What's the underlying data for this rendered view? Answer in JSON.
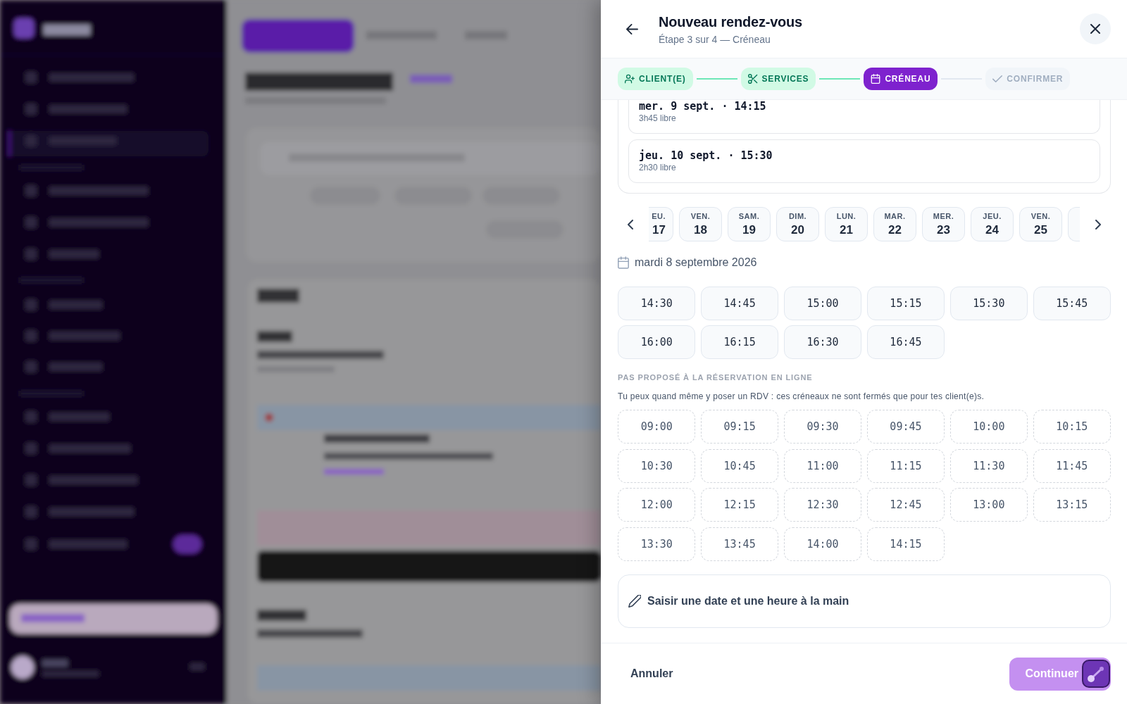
{
  "header": {
    "title": "Nouveau rendez-vous",
    "subtitle": "Étape 3 sur 4 — Créneau"
  },
  "steps": [
    {
      "label": "CLIENT(E)",
      "completed": true,
      "selected": false
    },
    {
      "label": "SERVICES",
      "completed": true,
      "selected": false
    },
    {
      "label": "CRÉNEAU",
      "completed": false,
      "selected": true
    },
    {
      "label": "CONFIRMER",
      "completed": false,
      "selected": false
    }
  ],
  "suggestions": [
    {
      "title": "mer. 9 sept. · 14:15",
      "note": "3h45 libre",
      "selected": false
    },
    {
      "title": "jeu. 10 sept. · 15:30",
      "note": "2h30 libre",
      "selected": false
    }
  ],
  "days": [
    {
      "weekday": "EU.",
      "day": "17",
      "partial": true,
      "selected": false
    },
    {
      "weekday": "VEN.",
      "day": "18",
      "partial": false,
      "selected": false
    },
    {
      "weekday": "SAM.",
      "day": "19",
      "partial": false,
      "selected": false
    },
    {
      "weekday": "DIM.",
      "day": "20",
      "partial": false,
      "selected": false
    },
    {
      "weekday": "LUN.",
      "day": "21",
      "partial": false,
      "selected": false
    },
    {
      "weekday": "MAR.",
      "day": "22",
      "partial": false,
      "selected": false
    },
    {
      "weekday": "MER.",
      "day": "23",
      "partial": false,
      "selected": false
    },
    {
      "weekday": "JEU.",
      "day": "24",
      "partial": false,
      "selected": false
    },
    {
      "weekday": "VEN.",
      "day": "25",
      "partial": false,
      "selected": false
    },
    {
      "partial": true,
      "selected": false
    }
  ],
  "date_label": "mardi 8 septembre 2026",
  "slots": [
    {
      "time": "14:30",
      "selected": false
    },
    {
      "time": "14:45",
      "selected": false
    },
    {
      "time": "15:00",
      "selected": false
    },
    {
      "time": "15:15",
      "selected": false
    },
    {
      "time": "15:30",
      "selected": false
    },
    {
      "time": "15:45",
      "selected": false
    },
    {
      "time": "16:00",
      "selected": false
    },
    {
      "time": "16:15",
      "selected": false
    },
    {
      "time": "16:30",
      "selected": false
    },
    {
      "time": "16:45",
      "selected": false
    }
  ],
  "offline": {
    "heading": "PAS PROPOSÉ À LA RÉSERVATION EN LIGNE",
    "note": "Tu peux quand même y poser un RDV : ces créneaux ne sont fermés que pour tes client(e)s.",
    "slots": [
      {
        "time": "09:00",
        "selected": false
      },
      {
        "time": "09:15",
        "selected": false
      },
      {
        "time": "09:30",
        "selected": false
      },
      {
        "time": "09:45",
        "selected": false
      },
      {
        "time": "10:00",
        "selected": false
      },
      {
        "time": "10:15",
        "selected": false
      },
      {
        "time": "10:30",
        "selected": false
      },
      {
        "time": "10:45",
        "selected": false
      },
      {
        "time": "11:00",
        "selected": false
      },
      {
        "time": "11:15",
        "selected": false
      },
      {
        "time": "11:30",
        "selected": false
      },
      {
        "time": "11:45",
        "selected": false
      },
      {
        "time": "12:00",
        "selected": false
      },
      {
        "time": "12:15",
        "selected": false
      },
      {
        "time": "12:30",
        "selected": false
      },
      {
        "time": "12:45",
        "selected": false
      },
      {
        "time": "13:00",
        "selected": false
      },
      {
        "time": "13:15",
        "selected": false
      },
      {
        "time": "13:30",
        "selected": false
      },
      {
        "time": "13:45",
        "selected": false
      },
      {
        "time": "14:00",
        "selected": false
      },
      {
        "time": "14:15",
        "selected": false
      }
    ]
  },
  "manual_entry": "Saisir une date et une heure à la main",
  "footer": {
    "cancel": "Annuler",
    "continue": {
      "label": "Continuer",
      "disabled": true
    }
  }
}
